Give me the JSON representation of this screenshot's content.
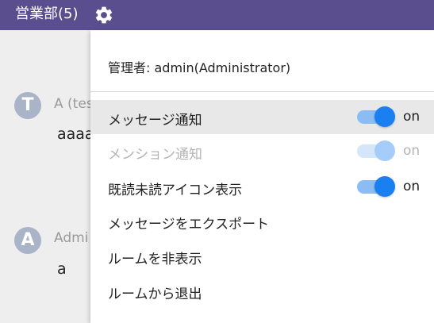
{
  "header": {
    "room_title": "営業部(5)",
    "settings_icon": "gear-icon",
    "background_color": "#5a4e8e"
  },
  "chat": {
    "messages": [
      {
        "avatar_letter": "T",
        "name": "A (tes",
        "text": "aaaa"
      },
      {
        "avatar_letter": "A",
        "name": "Admi",
        "text": "a"
      }
    ]
  },
  "menu": {
    "admin_label": "管理者: admin(Administrator)",
    "items": [
      {
        "label": "メッセージ通知",
        "toggle": true,
        "state_label": "on",
        "enabled": true
      },
      {
        "label": "メンション通知",
        "toggle": true,
        "state_label": "on",
        "enabled": false
      },
      {
        "label": "既読未読アイコン表示",
        "toggle": true,
        "state_label": "on",
        "enabled": true
      },
      {
        "label": "メッセージをエクスポート"
      },
      {
        "label": "ルームを非表示"
      },
      {
        "label": "ルームから退出"
      }
    ]
  },
  "colors": {
    "accent": "#1a7ff0",
    "header": "#5a4e8e",
    "highlight": "#e8e8e8"
  }
}
